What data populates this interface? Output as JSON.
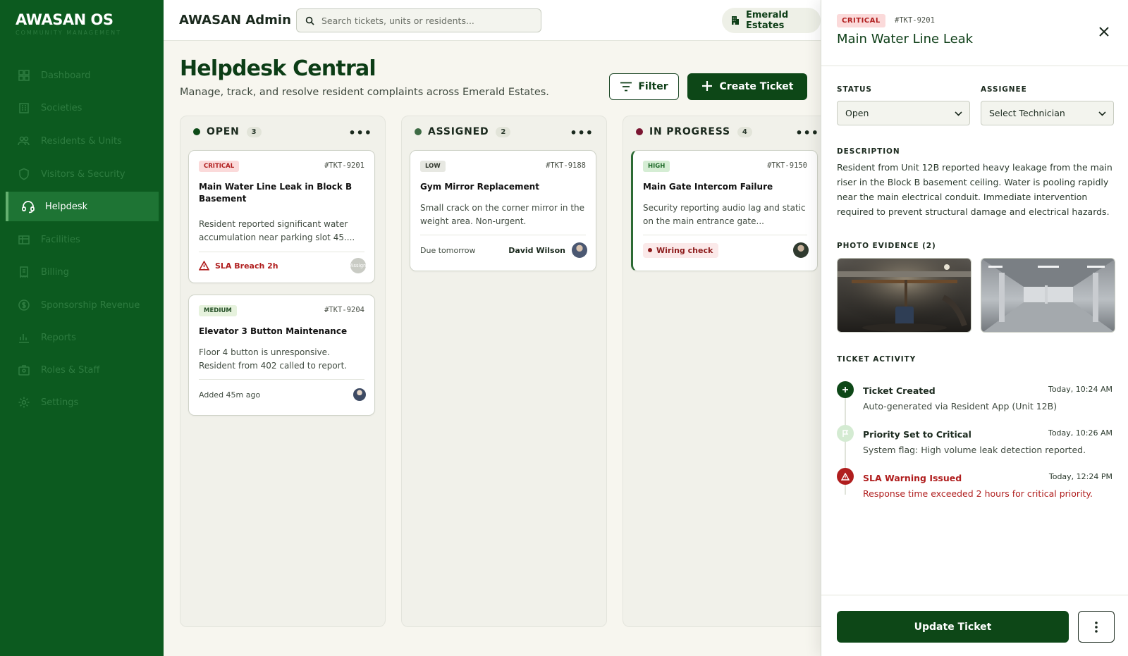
{
  "sidebar": {
    "logo": "AWASAN OS",
    "logo_sub": "COMMUNITY MANAGEMENT",
    "items": [
      {
        "label": "Dashboard",
        "icon": "grid-icon"
      },
      {
        "label": "Societies",
        "icon": "building-icon"
      },
      {
        "label": "Residents & Units",
        "icon": "users-icon"
      },
      {
        "label": "Visitors & Security",
        "icon": "shield-icon"
      },
      {
        "label": "Helpdesk",
        "icon": "headset-icon",
        "active": true
      },
      {
        "label": "Facilities",
        "icon": "facility-icon"
      },
      {
        "label": "Billing",
        "icon": "receipt-icon"
      },
      {
        "label": "Sponsorship Revenue",
        "icon": "coin-icon"
      },
      {
        "label": "Reports",
        "icon": "chart-icon"
      },
      {
        "label": "Roles & Staff",
        "icon": "badge-icon"
      },
      {
        "label": "Settings",
        "icon": "gear-icon"
      }
    ]
  },
  "topbar": {
    "brand": "AWASAN Admin",
    "search_placeholder": "Search tickets, units or residents...",
    "estate": "Emerald Estates"
  },
  "page": {
    "title": "Helpdesk Central",
    "subtitle": "Manage, track, and resolve resident complaints across Emerald Estates.",
    "filter_label": "Filter",
    "create_label": "Create Ticket"
  },
  "columns": [
    {
      "title": "OPEN",
      "count": "3",
      "color": "#0c4a17",
      "cards": [
        {
          "priority": "CRITICAL",
          "id": "#TKT-9201",
          "title": "Main Water Line Leak in Block B Basement",
          "desc": "Resident reported significant water accumulation near parking slot 45....",
          "sla": "SLA Breach 2h",
          "avatar_text": "Assign"
        },
        {
          "priority": "MEDIUM",
          "id": "#TKT-9204",
          "title": "Elevator 3 Button Maintenance",
          "desc": "Floor 4 button is unresponsive. Resident from 402 called to report.",
          "footer": "Added 45m ago"
        }
      ]
    },
    {
      "title": "ASSIGNED",
      "count": "2",
      "color": "#3e6b45",
      "cards": [
        {
          "priority": "LOW",
          "id": "#TKT-9188",
          "title": "Gym Mirror Replacement",
          "desc": "Small crack on the corner mirror in the weight area. Non-urgent.",
          "footer": "Due tomorrow",
          "assignee": "David Wilson"
        }
      ]
    },
    {
      "title": "IN PROGRESS",
      "count": "4",
      "color": "#7a1531",
      "cards": [
        {
          "priority": "HIGH",
          "id": "#TKT-9150",
          "title": "Main Gate Intercom Failure",
          "desc": "Security reporting audio lag and static on the main entrance gate...",
          "tag": "Wiring check"
        }
      ]
    }
  ],
  "drawer": {
    "priority": "CRITICAL",
    "id": "#TKT-9201",
    "title": "Main Water Line Leak",
    "status_label": "STATUS",
    "status_value": "Open",
    "assignee_label": "ASSIGNEE",
    "assignee_value": "Select Technician",
    "description_label": "DESCRIPTION",
    "description": "Resident from Unit 12B reported heavy leakage from the main riser in the Block B basement ceiling. Water is pooling rapidly near the main electrical conduit. Immediate intervention required to prevent structural damage and electrical hazards.",
    "photos_label": "PHOTO EVIDENCE (2)",
    "activity_label": "TICKET ACTIVITY",
    "activity": [
      {
        "title": "Ticket Created",
        "time": "Today, 10:24 AM",
        "desc": "Auto-generated via Resident App (Unit 12B)"
      },
      {
        "title": "Priority Set to Critical",
        "time": "Today, 10:26 AM",
        "desc": "System flag: High volume leak detection reported."
      },
      {
        "title": "SLA Warning Issued",
        "time": "Today, 12:24 PM",
        "desc": "Response time exceeded 2 hours for critical priority."
      }
    ],
    "update_label": "Update Ticket"
  },
  "colors": {
    "sidebar": "#0c5a1f",
    "primary": "#0d4717",
    "critical": "#b01e1e",
    "background": "#f7f6ef"
  }
}
